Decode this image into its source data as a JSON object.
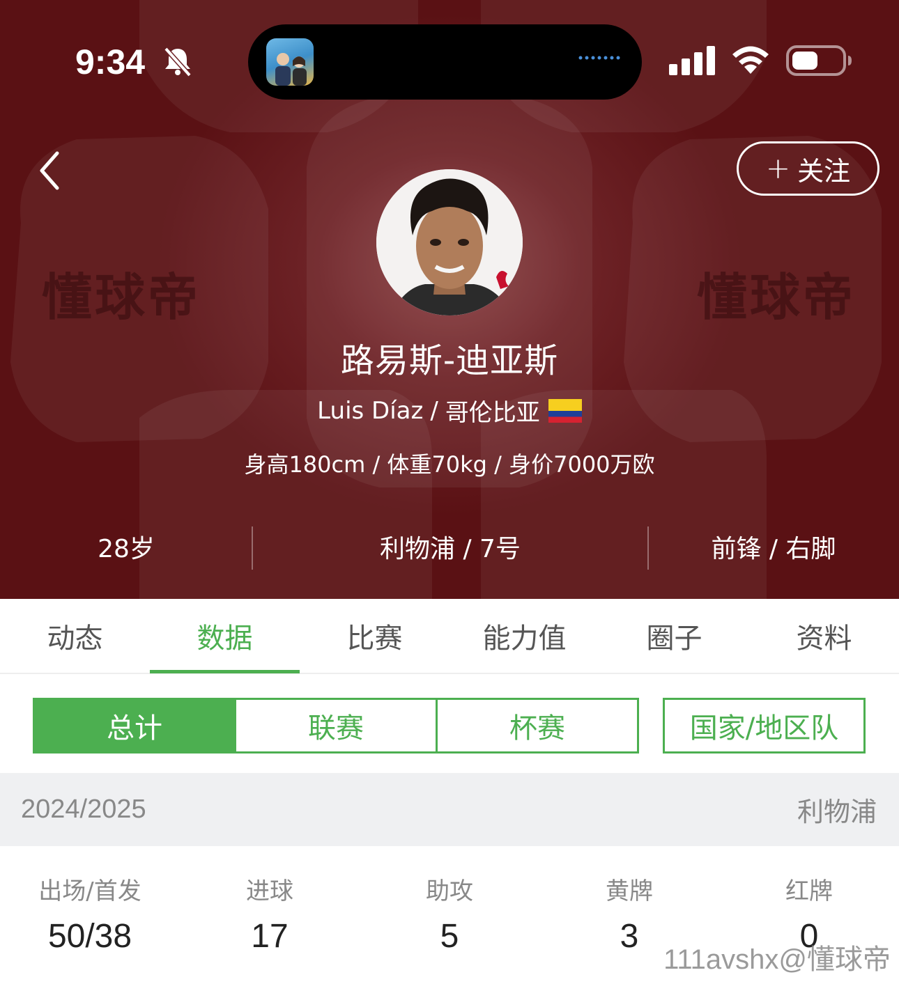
{
  "status_bar": {
    "time": "9:34"
  },
  "header": {
    "follow_label": "关注",
    "watermark_text": "懂球帝",
    "player_name": "路易斯-迪亚斯",
    "english_name": "Luis Díaz",
    "nationality": "哥伦比亚",
    "metrics": "身高180cm / 体重70kg / 身价7000万欧",
    "age": "28岁",
    "club_number": "利物浦 / 7号",
    "position_foot": "前锋 / 右脚",
    "colors": {
      "header_bg": "#5a1114",
      "accent": "#4caf50"
    }
  },
  "tabs": [
    {
      "label": "动态"
    },
    {
      "label": "数据",
      "active": true
    },
    {
      "label": "比赛"
    },
    {
      "label": "能力值"
    },
    {
      "label": "圈子"
    },
    {
      "label": "资料"
    }
  ],
  "segments": [
    {
      "label": "总计",
      "active": true
    },
    {
      "label": "联赛"
    },
    {
      "label": "杯赛"
    }
  ],
  "national_team_label": "国家/地区队",
  "season": {
    "label": "2024/2025",
    "team": "利物浦"
  },
  "stats": [
    {
      "label": "出场/首发",
      "value": "50/38"
    },
    {
      "label": "进球",
      "value": "17"
    },
    {
      "label": "助攻",
      "value": "5"
    },
    {
      "label": "黄牌",
      "value": "3"
    },
    {
      "label": "红牌",
      "value": "0"
    }
  ],
  "corner_watermark": "111avshx@懂球帝"
}
